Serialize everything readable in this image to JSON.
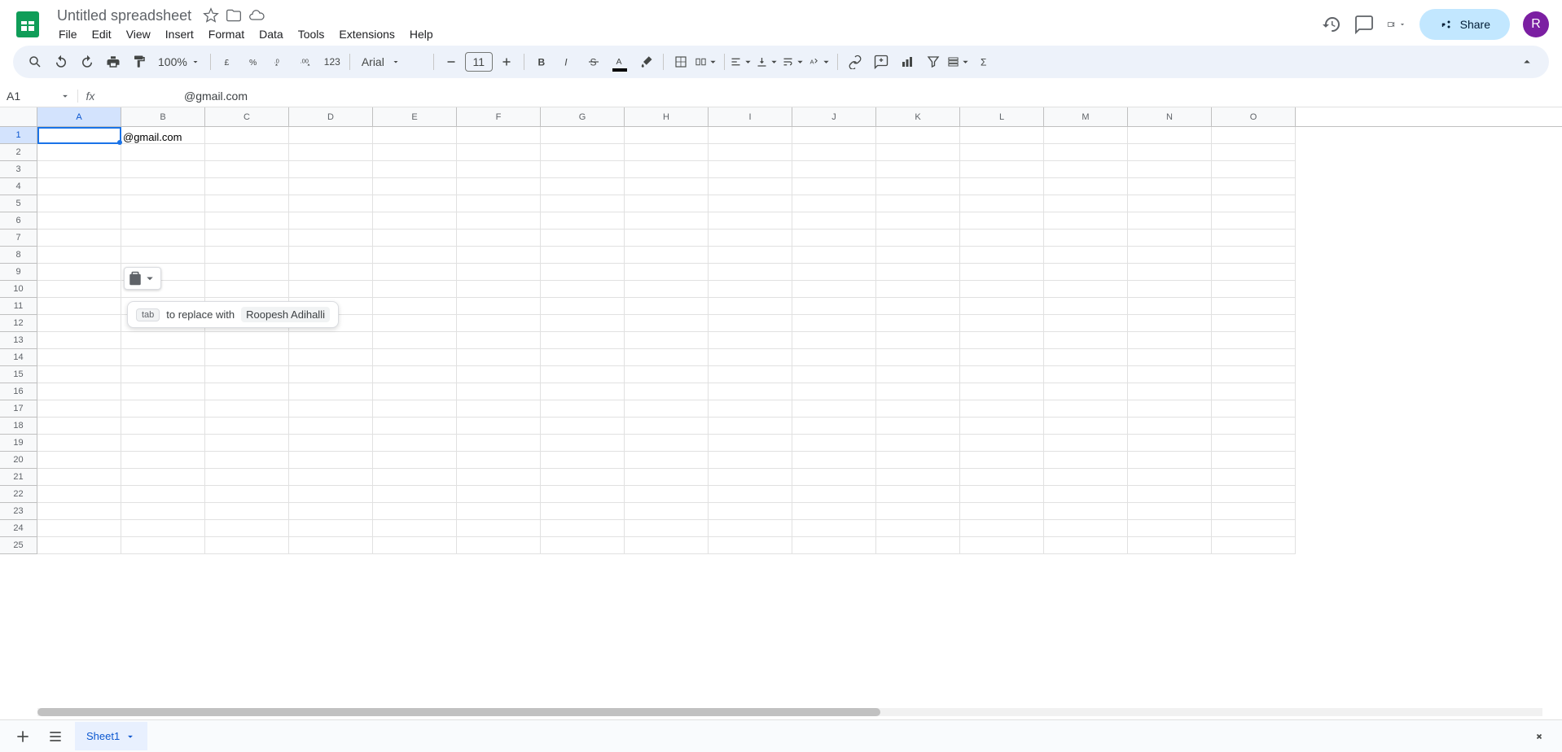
{
  "header": {
    "doc_title": "Untitled spreadsheet",
    "avatar_letter": "R",
    "share_label": "Share"
  },
  "menu": {
    "items": [
      "File",
      "Edit",
      "View",
      "Insert",
      "Format",
      "Data",
      "Tools",
      "Extensions",
      "Help"
    ]
  },
  "toolbar": {
    "zoom": "100%",
    "font_name": "Arial",
    "font_size": "11",
    "number_format_label": "123"
  },
  "name_box": {
    "value": "A1"
  },
  "formula_bar": {
    "value": "@gmail.com"
  },
  "grid": {
    "columns": [
      "A",
      "B",
      "C",
      "D",
      "E",
      "F",
      "G",
      "H",
      "I",
      "J",
      "K",
      "L",
      "M",
      "N",
      "O"
    ],
    "row_count": 25,
    "active_cell": "A1",
    "cells": {
      "A1": "@gmail.com"
    }
  },
  "smart_chip": {
    "tab_label": "tab",
    "prompt": "to replace with",
    "suggestion": "Roopesh Adihalli"
  },
  "footer": {
    "sheet_name": "Sheet1"
  }
}
